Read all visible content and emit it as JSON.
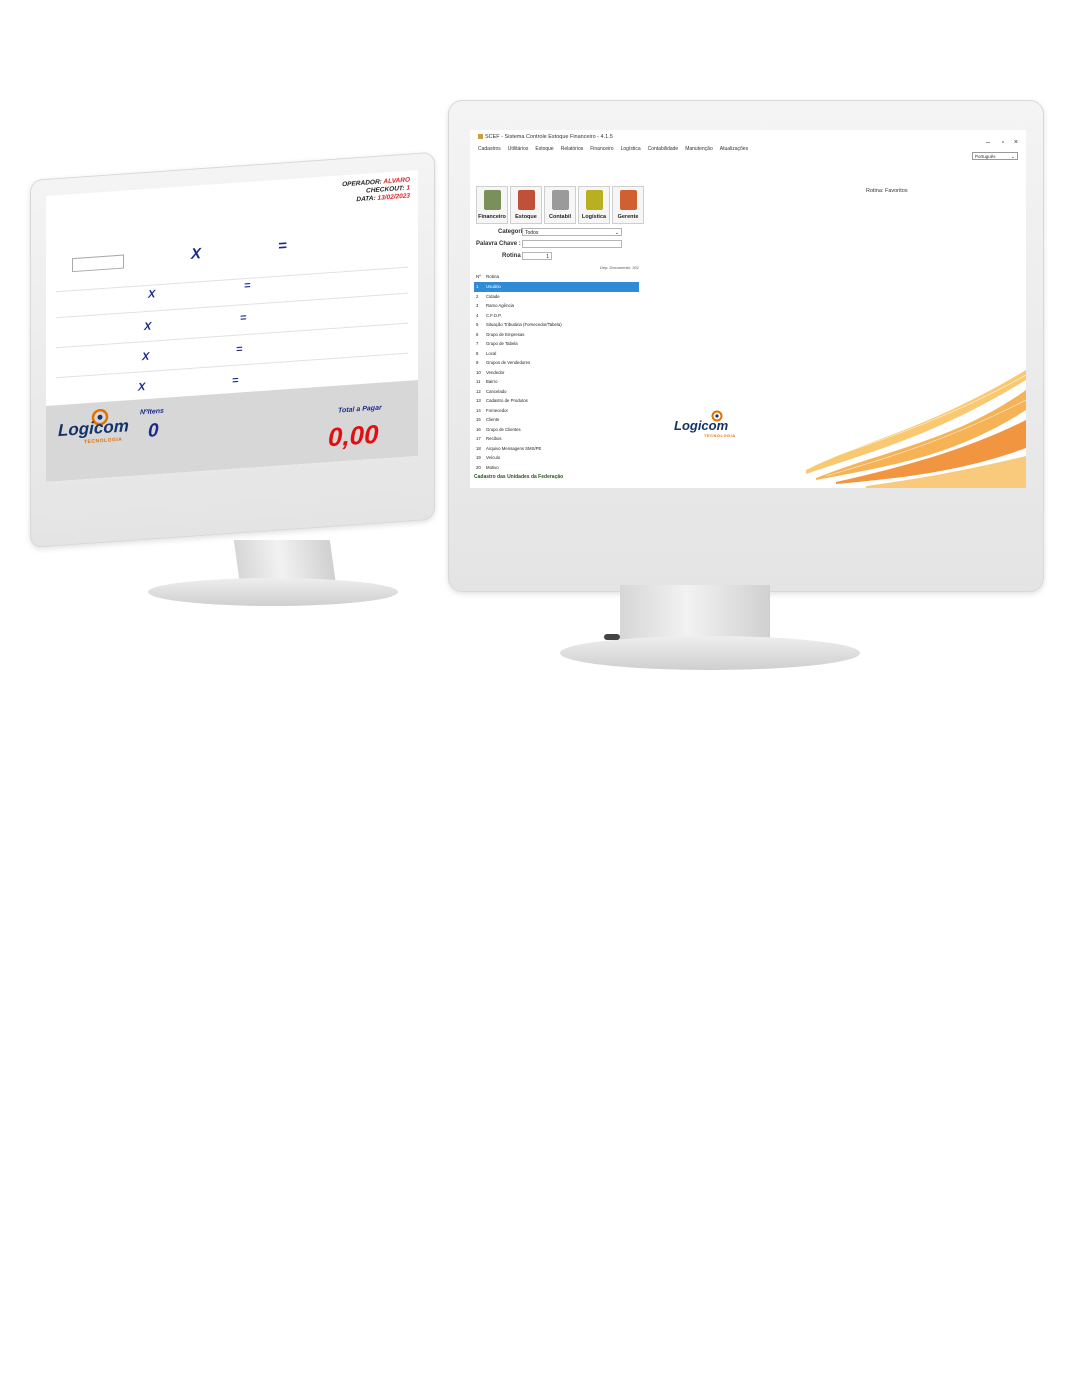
{
  "pos": {
    "title_small": "",
    "operador_label": "OPERADOR:",
    "operador_value": "ALVARO",
    "checkout_label": "CHECKOUT:",
    "checkout_value": "1",
    "data_label": "DATA:",
    "data_value": "13/02/2023",
    "rows": [
      {
        "x": "X",
        "eq": "="
      },
      {
        "x": "X",
        "eq": "="
      },
      {
        "x": "X",
        "eq": "="
      },
      {
        "x": "X",
        "eq": "="
      },
      {
        "x": "X",
        "eq": "="
      }
    ],
    "logo": {
      "name": "Logicom",
      "sub": "TECNOLOGIA"
    },
    "itens_label": "NºItens",
    "itens_value": "0",
    "total_label": "Total a Pagar",
    "total_value": "0,00"
  },
  "erp": {
    "window_title": "SCEF - Sistema Controle Estoque Financeiro - 4.1.5",
    "window_controls": [
      "–",
      "▫",
      "×"
    ],
    "menu": [
      "Cadastros",
      "Utilitários",
      "Estoque",
      "Relatórios",
      "Financeiro",
      "Logística",
      "Contabilidade",
      "Manutenção",
      "Atualizações"
    ],
    "language": "Português",
    "rotina_title": "Rotina: Favoritos",
    "modules": [
      {
        "label": "Financeiro",
        "icon": "cash-register-icon",
        "color": "#7a8f5a"
      },
      {
        "label": "Estoque",
        "icon": "boxes-icon",
        "color": "#c0503a"
      },
      {
        "label": "Contabil",
        "icon": "calculator-icon",
        "color": "#9a9a9a"
      },
      {
        "label": "Logística",
        "icon": "truck-icon",
        "color": "#b8b020"
      },
      {
        "label": "Gerente",
        "icon": "manager-icon",
        "color": "#d06030"
      }
    ],
    "form": {
      "categoria_label": "Categoria :",
      "categoria_value": "Todos",
      "palavra_label": "Palavra Chave :",
      "palavra_value": "",
      "rotina_label": "Rotina :",
      "rotina_value": "1"
    },
    "pesquisa_label": "Dep. Documento: 301",
    "list_header": {
      "n": "Nº",
      "name": "Rotina"
    },
    "list": [
      {
        "n": "1",
        "name": "Usuário",
        "selected": true
      },
      {
        "n": "2",
        "name": "Cidade"
      },
      {
        "n": "3",
        "name": "Ramo Agência"
      },
      {
        "n": "4",
        "name": "C.F.O.P."
      },
      {
        "n": "5",
        "name": "Situação Tributária (Fornecedor/Tabela)"
      },
      {
        "n": "6",
        "name": "Grupo de Empresas"
      },
      {
        "n": "7",
        "name": "Grupo de Tabela"
      },
      {
        "n": "8",
        "name": "Local"
      },
      {
        "n": "9",
        "name": "Grupos de Vendedores"
      },
      {
        "n": "10",
        "name": "Vendedor"
      },
      {
        "n": "11",
        "name": "Bairro"
      },
      {
        "n": "12",
        "name": "Cancelado"
      },
      {
        "n": "13",
        "name": "Cadastro de Produtos"
      },
      {
        "n": "14",
        "name": "Fornecedor"
      },
      {
        "n": "15",
        "name": "Cliente"
      },
      {
        "n": "16",
        "name": "Grupo de Clientes"
      },
      {
        "n": "17",
        "name": "Recibos"
      },
      {
        "n": "18",
        "name": "Arquivo Mensagens SMS/PE"
      },
      {
        "n": "19",
        "name": "Veículo"
      },
      {
        "n": "20",
        "name": "Motivo"
      }
    ],
    "status": "Cadastro das Unidades da Federação",
    "logo": {
      "name": "Logicom",
      "sub": "TECNOLOGIA"
    }
  }
}
